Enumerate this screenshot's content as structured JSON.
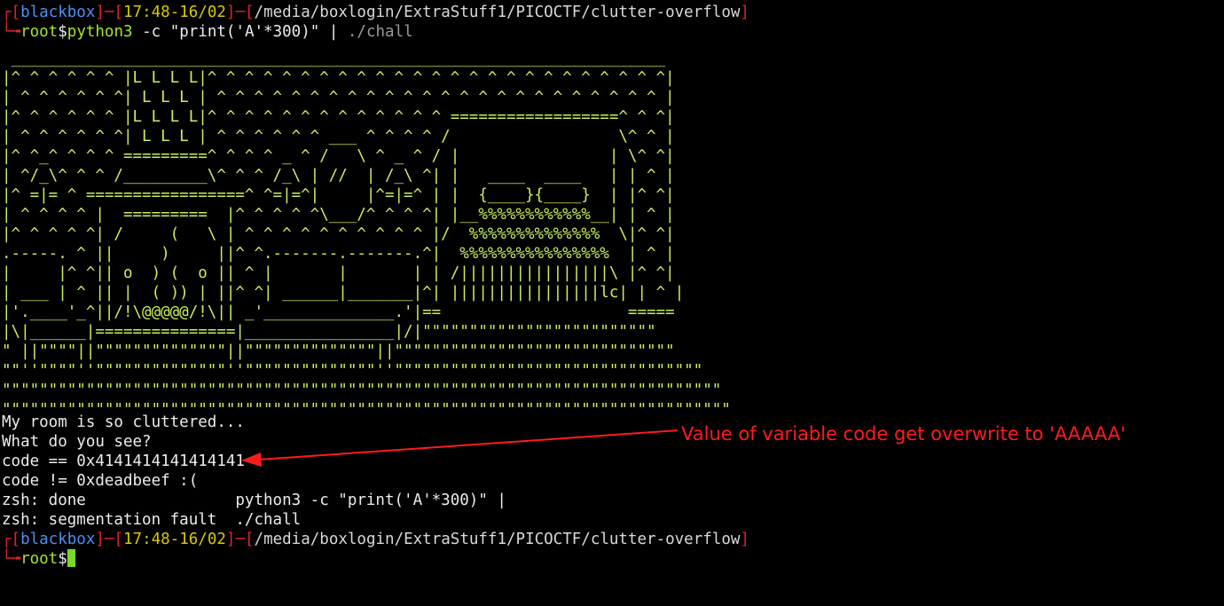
{
  "prompt1": {
    "user": "blackbox",
    "time": "17:48-16/02",
    "path": "/media/boxlogin/ExtraStuff1/PICOCTF/clutter-overflow",
    "root": "root",
    "dollar": "$",
    "cmd_py": "python3",
    "cmd_flag": " -c ",
    "cmd_str": "\"print('A'*300)\"",
    "cmd_pipe": " | ",
    "cmd_bin": "./chall"
  },
  "ascii_art": [
    " ______________________________________________________________________",
    "|^ ^ ^ ^ ^ ^ |L L L L|^ ^ ^ ^ ^ ^ ^ ^ ^ ^ ^ ^ ^ ^ ^ ^ ^ ^ ^ ^ ^ ^ ^ ^ ^|",
    "| ^ ^ ^ ^ ^ ^| L L L | ^ ^ ^ ^ ^ ^ ^ ^ ^ ^ ^ ^ ^ ^ ^ ^ ^ ^ ^ ^ ^ ^ ^ ^ |",
    "|^ ^ ^ ^ ^ ^ |L L L L|^ ^ ^ ^ ^ ^ ^ ^ ^ ^ ^ ^ ^ ==================^ ^ ^|",
    "| ^ ^ ^ ^ ^ ^| L L L | ^ ^ ^ ^ ^ ^ ___ ^ ^ ^ ^ /                  \\^ ^ |",
    "|^ ^_^ ^ ^ ^ =========^ ^ ^ ^ _ ^ /   \\ ^ _ ^ / |                | \\^ ^|",
    "| ^/_\\^ ^ ^ /_________\\^ ^ ^ /_\\ | //  | /_\\ ^| |   ____  ____   | | ^ |",
    "|^ =|= ^ =================^ ^=|=^|     |^=|=^ | |  {____}{____}  | |^ ^|",
    "| ^ ^ ^ ^ |  =========  |^ ^ ^ ^ ^\\___/^ ^ ^ ^| |__%%%%%%%%%%%%__| | ^ |",
    "|^ ^ ^ ^ ^| /     (   \\ | ^ ^ ^ ^ ^ ^ ^ ^ ^ ^ |/  %%%%%%%%%%%%%%  \\|^ ^|",
    ".-----. ^ ||     )     ||^ ^.-------.-------.^|  %%%%%%%%%%%%%%%%  | ^ |",
    "|     |^ ^|| o  ) (  o || ^ |       |       | | /||||||||||||||||\\ |^ ^|",
    "| ___ | ^ || |  ( )) | ||^ ^| ______|_______|^| ||||||||||||||||lc| | ^ |",
    "|'.____'_^||/!\\@@@@@/!\\|| _'______________.'|==                    =====",
    "|\\|______|===============|________________|/|\"\"\"\"\"\"\"\"\"\"\"\"\"\"\"\"\"\"\"\"\"\"\"\"\"",
    "\" ||\"\"\"\"||\"\"\"\"\"\"\"\"\"\"\"\"\"\"||\"\"\"\"\"\"\"\"\"\"\"\"\"\"||\"\"\"\"\"\"\"\"\"\"\"\"\"\"\"\"\"\"\"\"\"\"\"\"\"\"\"\"\"\"",
    "\"\"''\"\"\"\"''\"\"\"\"\"\"\"\"\"\"\"\"\"\"''\"\"\"\"\"\"\"\"\"\"\"\"\"\"''\"\"\"\"\"\"\"\"\"\"\"\"\"\"\"\"\"\"\"\"\"\"\"\"\"\"\"\"\"\"\"\"\"",
    "\"\"\"\"\"\"\"\"\"\"\"\"\"\"\"\"\"\"\"\"\"\"\"\"\"\"\"\"\"\"\"\"\"\"\"\"\"\"\"\"\"\"\"\"\"\"\"\"\"\"\"\"\"\"\"\"\"\"\"\"\"\"\"\"\"\"\"\"\"\"\"\"\"\"\"\"\"",
    "\"\"\"\"\"\"\"\"\"\"\"\"\"\"\"\"\"\"\"\"\"\"\"\"\"\"\"\"\"\"\"\"\"\"\"\"\"\"\"\"\"\"\"\"\"\"\"\"\"\"\"\"\"\"\"\"\"\"\"\"\"\"\"\"\"\"\"\"\"\"\"\"\"\"\"\"\"\""
  ],
  "output": [
    "My room is so cluttered...",
    "What do you see?",
    "code == 0x4141414141414141",
    "code != 0xdeadbeef :(",
    "zsh: done                python3 -c \"print('A'*300)\" |",
    "zsh: segmentation fault  ./chall"
  ],
  "prompt2": {
    "user": "blackbox",
    "time": "17:48-16/02",
    "path": "/media/boxlogin/ExtraStuff1/PICOCTF/clutter-overflow",
    "root": "root",
    "dollar": "$"
  },
  "annotation": {
    "text": "Value of variable code get overwrite to 'AAAAA'",
    "color": "#ff1b1b"
  },
  "colors": {
    "background": "#000000",
    "prompt_bracket": "#e0202a",
    "user": "#4f8ff5",
    "time": "#d9c900",
    "root": "#a6e22e",
    "art": "#c8f060",
    "cursor": "#7bd62c"
  }
}
